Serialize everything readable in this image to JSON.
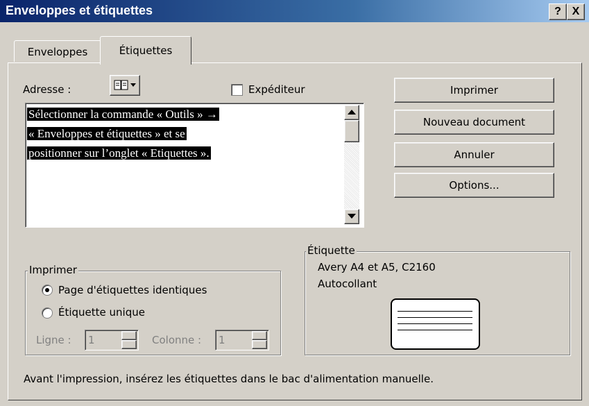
{
  "window": {
    "title": "Enveloppes et étiquettes",
    "help_btn": "?",
    "close_btn": "X"
  },
  "tabs": [
    {
      "label": "Enveloppes",
      "active": false
    },
    {
      "label": "Étiquettes",
      "active": true
    }
  ],
  "address": {
    "label": "Adresse :",
    "address_book_icon": "address-book-icon",
    "sender_checkbox_label": "Expéditeur",
    "sender_checked": false,
    "lines": [
      "Sélectionner la commande « Outils » →",
      "« Enveloppes et étiquettes » et se",
      "positionner sur l’onglet « Etiquettes »."
    ]
  },
  "buttons": {
    "print": "Imprimer",
    "new_document": "Nouveau document",
    "cancel": "Annuler",
    "options": "Options..."
  },
  "print_group": {
    "legend": "Imprimer",
    "option_full_page": "Page d'étiquettes identiques",
    "option_single": "Étiquette unique",
    "selected": "full_page",
    "row_label": "Ligne :",
    "row_value": "1",
    "col_label": "Colonne :",
    "col_value": "1"
  },
  "label_group": {
    "legend": "Étiquette",
    "product": "Avery A4 et A5, C2160",
    "type": "Autocollant"
  },
  "footer_hint": "Avant l'impression, insérez les étiquettes dans le bac d'alimentation manuelle.",
  "colors": {
    "titlebar_start": "#0a246a",
    "titlebar_end": "#a6caf0",
    "face": "#d4d0c8",
    "selection": "#000000"
  }
}
